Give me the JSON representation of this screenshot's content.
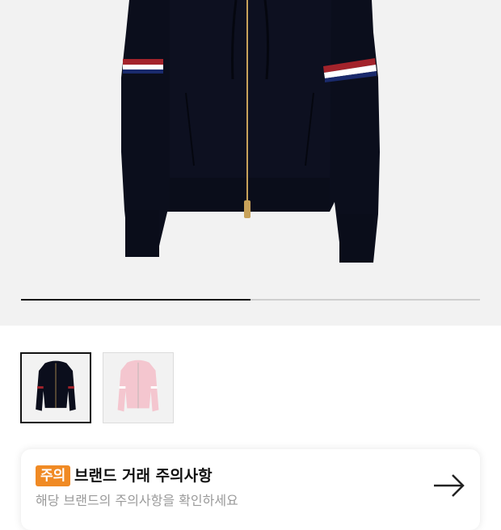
{
  "gallery": {
    "current_index": 1,
    "total": 2,
    "progress_fraction": 0.5,
    "thumbnails": [
      {
        "color": "#0b0e1c",
        "selected": true
      },
      {
        "color": "#f4c6cf",
        "selected": false
      }
    ]
  },
  "notice": {
    "badge": "주의",
    "title": "브랜드 거래 주의사항",
    "subtitle": "해당 브랜드의 주의사항을 확인하세요",
    "icon": "arrow-right-icon"
  },
  "colors": {
    "hero_bg": "#f2f2f2",
    "garment": "#0b0e1c",
    "stripe_red": "#a3232b",
    "stripe_white": "#ffffff",
    "zipper": "#c8a25a",
    "badge": "#f08a24"
  }
}
